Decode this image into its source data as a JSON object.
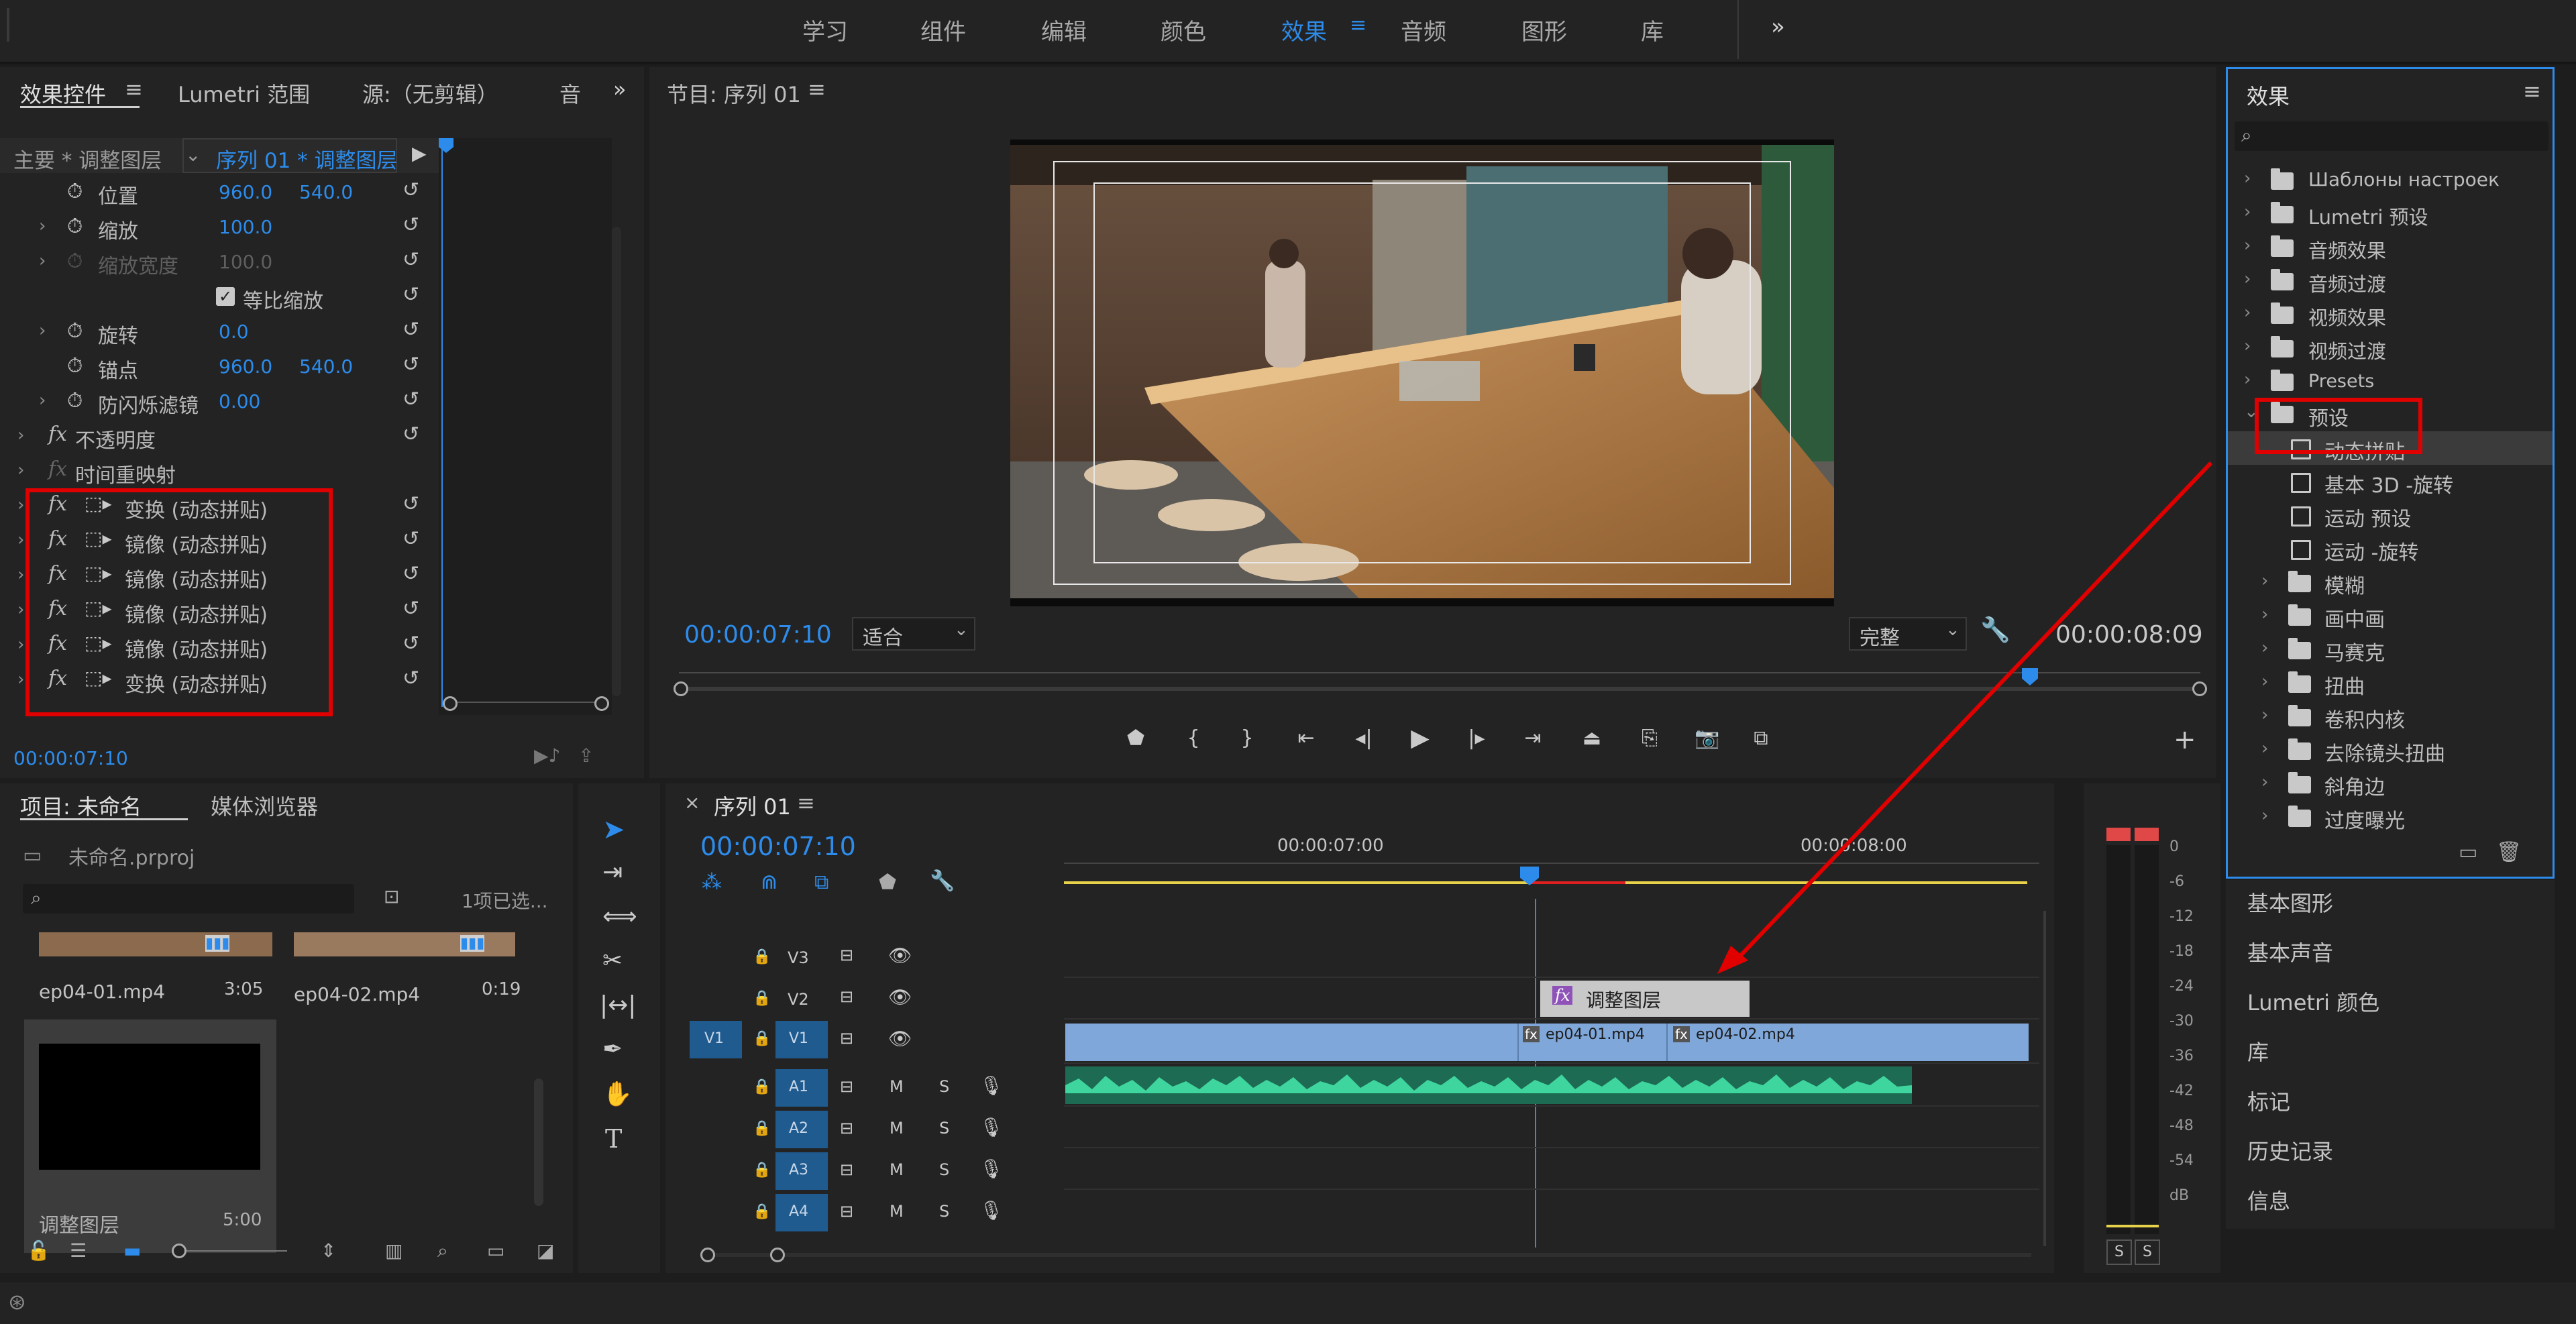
{
  "workspaces": {
    "items": [
      "学习",
      "组件",
      "编辑",
      "颜色",
      "效果",
      "音频",
      "图形",
      "库"
    ],
    "active": "效果",
    "more": "»"
  },
  "effect_controls": {
    "tab_label": "效果控件",
    "tab_menu": "≡",
    "tab_lumetri": "Lumetri 范围",
    "tab_source": "源:（无剪辑）",
    "tab_audio": "音",
    "master_label": "主要 * 调整图层",
    "sequence_label": "序列 01 * 调整图层",
    "properties": [
      {
        "label": "位置",
        "v1": "960.0",
        "v2": "540.0"
      },
      {
        "label": "缩放",
        "v1": "100.0",
        "v2": ""
      },
      {
        "label": "缩放宽度",
        "v1": "100.0",
        "v2": ""
      },
      {
        "label": "等比缩放",
        "v1": "",
        "v2": ""
      },
      {
        "label": "旋转",
        "v1": "0.0",
        "v2": ""
      },
      {
        "label": "锚点",
        "v1": "960.0",
        "v2": "540.0"
      },
      {
        "label": "防闪烁滤镜",
        "v1": "0.00",
        "v2": ""
      }
    ],
    "fx_rows": [
      {
        "label": "不透明度"
      },
      {
        "label": "时间重映射"
      },
      {
        "label": "变换 (动态拼贴)"
      },
      {
        "label": "镜像 (动态拼贴)"
      },
      {
        "label": "镜像 (动态拼贴)"
      },
      {
        "label": "镜像 (动态拼贴)"
      },
      {
        "label": "镜像 (动态拼贴)"
      },
      {
        "label": "变换 (动态拼贴)"
      }
    ],
    "timecode": "00:00:07:10"
  },
  "program_monitor": {
    "tab_label": "节目: 序列 01",
    "tab_menu": "≡",
    "timecode_current": "00:00:07:10",
    "fit_select": "适合",
    "quality_select": "完整",
    "timecode_duration": "00:00:08:09"
  },
  "effects_panel": {
    "title": "效果",
    "menu": "≡",
    "search_placeholder": "",
    "items": [
      {
        "label": "Шаблоны настроек",
        "kind": "folder"
      },
      {
        "label": "Lumetri 预设",
        "kind": "folder"
      },
      {
        "label": "音频效果",
        "kind": "folder"
      },
      {
        "label": "音频过渡",
        "kind": "folder"
      },
      {
        "label": "视频效果",
        "kind": "folder"
      },
      {
        "label": "视频过渡",
        "kind": "folder"
      },
      {
        "label": "Presets",
        "kind": "folder"
      },
      {
        "label": "预设",
        "kind": "folder-open"
      },
      {
        "label": "动态拼贴",
        "kind": "preset"
      },
      {
        "label": "基本 3D -旋转",
        "kind": "preset"
      },
      {
        "label": "运动 预设",
        "kind": "preset"
      },
      {
        "label": "运动 -旋转",
        "kind": "preset"
      },
      {
        "label": "模糊",
        "kind": "subfolder"
      },
      {
        "label": "画中画",
        "kind": "subfolder"
      },
      {
        "label": "马赛克",
        "kind": "subfolder"
      },
      {
        "label": "扭曲",
        "kind": "subfolder"
      },
      {
        "label": "卷积内核",
        "kind": "subfolder"
      },
      {
        "label": "去除镜头扭曲",
        "kind": "subfolder"
      },
      {
        "label": "斜角边",
        "kind": "subfolder"
      },
      {
        "label": "过度曝光",
        "kind": "subfolder"
      }
    ]
  },
  "side_panels": [
    "基本图形",
    "基本声音",
    "Lumetri 颜色",
    "库",
    "标记",
    "历史记录",
    "信息"
  ],
  "project": {
    "tab_label": "项目: 未命名",
    "tab_media": "媒体浏览器",
    "file": "未命名.prproj",
    "selection": "1项已选...",
    "items": [
      {
        "name": "ep04-01.mp4",
        "duration": "3:05"
      },
      {
        "name": "ep04-02.mp4",
        "duration": "0:19"
      },
      {
        "name": "调整图层",
        "duration": "5:00"
      }
    ]
  },
  "timeline": {
    "close": "×",
    "tab_label": "序列 01",
    "tab_menu": "≡",
    "timecode": "00:00:07:10",
    "ruler": [
      "00:00:07:00",
      "00:00:08:00"
    ],
    "tracks_video": [
      "V3",
      "V2",
      "V1"
    ],
    "source_patch": "V1",
    "tracks_audio": [
      "A1",
      "A2",
      "A3",
      "A4"
    ],
    "m_label": "M",
    "s_label": "S",
    "adjustment_clip": "调整图层",
    "clips": [
      "ep04-01.mp4",
      "ep04-02.mp4"
    ]
  },
  "audio_meter": {
    "scale": [
      "0",
      "-6",
      "-12",
      "-18",
      "-24",
      "-30",
      "-36",
      "-42",
      "-48",
      "-54",
      "dB"
    ],
    "solo_labels": [
      "S",
      "S"
    ]
  },
  "colors": {
    "accent": "#2d8ceb",
    "annotation": "#e00000",
    "video_clip": "#7fa7d9",
    "audio_clip": "#2fb487",
    "adjustment_clip": "#c8c8c8"
  }
}
